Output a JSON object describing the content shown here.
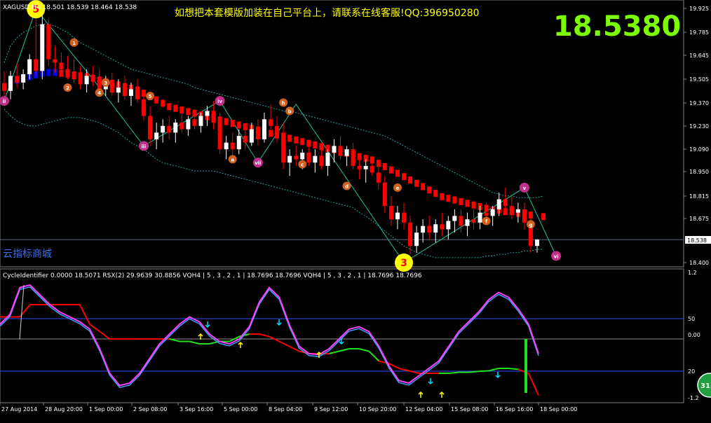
{
  "main": {
    "header": "XAGUSD,H4  18.501 18.539 18.464 18.538",
    "promo": "如想把本套模版加装在自己平台上，请联系在线客服!QQ:396950280",
    "big_price": "18.5380",
    "current_price_label": "18.538",
    "watermark": "云指标商城",
    "y_ticks": [
      "19.925",
      "19.785",
      "19.645",
      "19.505",
      "19.370",
      "19.230",
      "19.090",
      "18.950",
      "18.815",
      "18.675",
      "18.538",
      "18.400"
    ],
    "wave_labels": [
      {
        "label": "5",
        "kind": "yellow"
      },
      {
        "label": "3",
        "kind": "yellow"
      },
      {
        "label": "ii",
        "kind": "magenta"
      },
      {
        "label": "iii",
        "kind": "magenta"
      },
      {
        "label": "iv",
        "kind": "magenta"
      },
      {
        "label": "v",
        "kind": "magenta"
      },
      {
        "label": "vi",
        "kind": "magenta"
      },
      {
        "label": "vii",
        "kind": "magenta"
      },
      {
        "label": "1",
        "kind": "orange"
      },
      {
        "label": "2",
        "kind": "orange"
      },
      {
        "label": "3",
        "kind": "orange"
      },
      {
        "label": "4",
        "kind": "orange"
      },
      {
        "label": "5",
        "kind": "orange"
      },
      {
        "label": "a",
        "kind": "orange"
      },
      {
        "label": "b",
        "kind": "orange"
      },
      {
        "label": "c",
        "kind": "orange"
      },
      {
        "label": "d",
        "kind": "orange"
      },
      {
        "label": "e",
        "kind": "orange"
      },
      {
        "label": "f",
        "kind": "orange"
      },
      {
        "label": "g",
        "kind": "orange"
      },
      {
        "label": "h",
        "kind": "orange"
      }
    ]
  },
  "sub": {
    "header": "CycleIdentifier 0.0000 18.5071  RSX(2) 29.9639 30.8856  VQH4 | 5 , 3 , 2 , 1 |  18.7696 18.7696  VQH4 | 5 , 3 , 2 , 1 |  18.7696 18.7696",
    "y_ticks": [
      "1.2",
      "50",
      "0.00",
      "20",
      "-1.2"
    ]
  },
  "x_ticks": [
    "27 Aug 2014",
    "28 Aug 20:00",
    "1 Sep 00:00",
    "2 Sep 08:00",
    "3 Sep 16:00",
    "5 Sep 00:00",
    "8 Sep 04:00",
    "9 Sep 12:00",
    "10 Sep 20:00",
    "12 Sep 04:00",
    "15 Sep 08:00",
    "16 Sep 16:00",
    "18 Sep 00:00"
  ],
  "badge": "31",
  "colors": {
    "background": "#000000",
    "bull": "#ffffff",
    "bear": "#ff0000",
    "ma_red": "#ff0000",
    "ma_blue": "#0000ff",
    "band": "#2fa0a0",
    "zigzag": "#20c0a0",
    "rsx": "#ff40ff",
    "rsx2": "#40a0ff",
    "vq_red": "#ff0000",
    "vq_green": "#20e020",
    "level": "#3050ff",
    "price_line": "#8090b0",
    "yellow": "#ffff00",
    "magenta": "#c0308a",
    "orange": "#d06020",
    "big_price": "#7cfc00",
    "arrow_yellow": "#ffff00",
    "arrow_cyan": "#00e0ff"
  },
  "chart_data": [
    {
      "type": "candlestick",
      "title": "XAGUSD,H4",
      "ylim": [
        18.4,
        19.925
      ],
      "candles": [
        {
          "o": 19.45,
          "h": 19.55,
          "l": 19.4,
          "c": 19.43
        },
        {
          "o": 19.43,
          "h": 19.55,
          "l": 19.38,
          "c": 19.52
        },
        {
          "o": 19.52,
          "h": 19.6,
          "l": 19.45,
          "c": 19.48
        },
        {
          "o": 19.48,
          "h": 19.56,
          "l": 19.44,
          "c": 19.53
        },
        {
          "o": 19.53,
          "h": 19.65,
          "l": 19.5,
          "c": 19.62
        },
        {
          "o": 19.62,
          "h": 19.92,
          "l": 19.52,
          "c": 19.55
        },
        {
          "o": 19.55,
          "h": 19.9,
          "l": 19.5,
          "c": 19.83
        },
        {
          "o": 19.83,
          "h": 19.86,
          "l": 19.58,
          "c": 19.62
        },
        {
          "o": 19.62,
          "h": 19.7,
          "l": 19.54,
          "c": 19.6
        },
        {
          "o": 19.6,
          "h": 19.66,
          "l": 19.52,
          "c": 19.56
        },
        {
          "o": 19.56,
          "h": 19.64,
          "l": 19.5,
          "c": 19.54
        },
        {
          "o": 19.54,
          "h": 19.62,
          "l": 19.48,
          "c": 19.5
        },
        {
          "o": 19.5,
          "h": 19.58,
          "l": 19.44,
          "c": 19.47
        },
        {
          "o": 19.47,
          "h": 19.56,
          "l": 19.42,
          "c": 19.52
        },
        {
          "o": 19.52,
          "h": 19.58,
          "l": 19.46,
          "c": 19.5
        },
        {
          "o": 19.5,
          "h": 19.56,
          "l": 19.42,
          "c": 19.44
        },
        {
          "o": 19.44,
          "h": 19.52,
          "l": 19.4,
          "c": 19.48
        },
        {
          "o": 19.48,
          "h": 19.54,
          "l": 19.4,
          "c": 19.42
        },
        {
          "o": 19.42,
          "h": 19.5,
          "l": 19.36,
          "c": 19.45
        },
        {
          "o": 19.45,
          "h": 19.52,
          "l": 19.38,
          "c": 19.4
        },
        {
          "o": 19.4,
          "h": 19.48,
          "l": 19.34,
          "c": 19.44
        },
        {
          "o": 19.44,
          "h": 19.5,
          "l": 19.36,
          "c": 19.38
        },
        {
          "o": 19.38,
          "h": 19.44,
          "l": 19.25,
          "c": 19.28
        },
        {
          "o": 19.28,
          "h": 19.34,
          "l": 19.1,
          "c": 19.14
        },
        {
          "o": 19.14,
          "h": 19.24,
          "l": 19.08,
          "c": 19.18
        },
        {
          "o": 19.18,
          "h": 19.26,
          "l": 19.12,
          "c": 19.22
        },
        {
          "o": 19.22,
          "h": 19.28,
          "l": 19.14,
          "c": 19.18
        },
        {
          "o": 19.18,
          "h": 19.26,
          "l": 19.12,
          "c": 19.24
        },
        {
          "o": 19.24,
          "h": 19.3,
          "l": 19.18,
          "c": 19.2
        },
        {
          "o": 19.2,
          "h": 19.28,
          "l": 19.16,
          "c": 19.26
        },
        {
          "o": 19.26,
          "h": 19.32,
          "l": 19.2,
          "c": 19.22
        },
        {
          "o": 19.22,
          "h": 19.3,
          "l": 19.18,
          "c": 19.28
        },
        {
          "o": 19.28,
          "h": 19.34,
          "l": 19.22,
          "c": 19.31
        },
        {
          "o": 19.31,
          "h": 19.37,
          "l": 19.2,
          "c": 19.24
        },
        {
          "o": 19.24,
          "h": 19.3,
          "l": 19.05,
          "c": 19.08
        },
        {
          "o": 19.08,
          "h": 19.16,
          "l": 19.02,
          "c": 19.12
        },
        {
          "o": 19.12,
          "h": 19.18,
          "l": 19.04,
          "c": 19.08
        },
        {
          "o": 19.08,
          "h": 19.2,
          "l": 19.05,
          "c": 19.16
        },
        {
          "o": 19.16,
          "h": 19.22,
          "l": 19.08,
          "c": 19.12
        },
        {
          "o": 19.12,
          "h": 19.24,
          "l": 19.1,
          "c": 19.2
        },
        {
          "o": 19.2,
          "h": 19.26,
          "l": 19.1,
          "c": 19.14
        },
        {
          "o": 19.14,
          "h": 19.3,
          "l": 19.12,
          "c": 19.26
        },
        {
          "o": 19.26,
          "h": 19.35,
          "l": 19.2,
          "c": 19.22
        },
        {
          "o": 19.22,
          "h": 19.28,
          "l": 19.12,
          "c": 19.18
        },
        {
          "o": 19.18,
          "h": 19.24,
          "l": 18.96,
          "c": 19.0
        },
        {
          "o": 19.0,
          "h": 19.08,
          "l": 18.92,
          "c": 19.04
        },
        {
          "o": 19.04,
          "h": 19.1,
          "l": 18.98,
          "c": 19.02
        },
        {
          "o": 19.02,
          "h": 19.08,
          "l": 18.96,
          "c": 19.06
        },
        {
          "o": 19.06,
          "h": 19.12,
          "l": 18.98,
          "c": 19.0
        },
        {
          "o": 19.0,
          "h": 19.08,
          "l": 18.94,
          "c": 19.04
        },
        {
          "o": 19.04,
          "h": 19.1,
          "l": 18.96,
          "c": 18.98
        },
        {
          "o": 18.98,
          "h": 19.08,
          "l": 18.92,
          "c": 19.06
        },
        {
          "o": 19.06,
          "h": 19.14,
          "l": 19.0,
          "c": 19.1
        },
        {
          "o": 19.1,
          "h": 19.16,
          "l": 19.02,
          "c": 19.04
        },
        {
          "o": 19.04,
          "h": 19.1,
          "l": 18.98,
          "c": 19.08
        },
        {
          "o": 19.08,
          "h": 19.12,
          "l": 18.96,
          "c": 18.98
        },
        {
          "o": 18.98,
          "h": 19.04,
          "l": 18.9,
          "c": 18.96
        },
        {
          "o": 18.96,
          "h": 19.02,
          "l": 18.88,
          "c": 18.98
        },
        {
          "o": 18.98,
          "h": 19.04,
          "l": 18.92,
          "c": 18.94
        },
        {
          "o": 18.94,
          "h": 18.98,
          "l": 18.84,
          "c": 18.88
        },
        {
          "o": 18.88,
          "h": 18.92,
          "l": 18.7,
          "c": 18.74
        },
        {
          "o": 18.74,
          "h": 18.8,
          "l": 18.62,
          "c": 18.66
        },
        {
          "o": 18.66,
          "h": 18.74,
          "l": 18.6,
          "c": 18.7
        },
        {
          "o": 18.7,
          "h": 18.76,
          "l": 18.6,
          "c": 18.64
        },
        {
          "o": 18.64,
          "h": 18.68,
          "l": 18.45,
          "c": 18.5
        },
        {
          "o": 18.5,
          "h": 18.62,
          "l": 18.46,
          "c": 18.58
        },
        {
          "o": 18.58,
          "h": 18.66,
          "l": 18.52,
          "c": 18.62
        },
        {
          "o": 18.62,
          "h": 18.68,
          "l": 18.54,
          "c": 18.58
        },
        {
          "o": 18.58,
          "h": 18.66,
          "l": 18.52,
          "c": 18.63
        },
        {
          "o": 18.63,
          "h": 18.7,
          "l": 18.56,
          "c": 18.6
        },
        {
          "o": 18.6,
          "h": 18.68,
          "l": 18.54,
          "c": 18.65
        },
        {
          "o": 18.65,
          "h": 18.72,
          "l": 18.58,
          "c": 18.68
        },
        {
          "o": 18.68,
          "h": 18.72,
          "l": 18.58,
          "c": 18.62
        },
        {
          "o": 18.62,
          "h": 18.7,
          "l": 18.56,
          "c": 18.66
        },
        {
          "o": 18.66,
          "h": 18.72,
          "l": 18.6,
          "c": 18.64
        },
        {
          "o": 18.64,
          "h": 18.74,
          "l": 18.6,
          "c": 18.7
        },
        {
          "o": 18.7,
          "h": 18.76,
          "l": 18.64,
          "c": 18.68
        },
        {
          "o": 18.68,
          "h": 18.74,
          "l": 18.62,
          "c": 18.72
        },
        {
          "o": 18.72,
          "h": 18.82,
          "l": 18.68,
          "c": 18.78
        },
        {
          "o": 18.78,
          "h": 18.85,
          "l": 18.7,
          "c": 18.74
        },
        {
          "o": 18.74,
          "h": 18.8,
          "l": 18.66,
          "c": 18.7
        },
        {
          "o": 18.7,
          "h": 18.76,
          "l": 18.64,
          "c": 18.72
        },
        {
          "o": 18.72,
          "h": 18.76,
          "l": 18.6,
          "c": 18.64
        },
        {
          "o": 18.64,
          "h": 18.7,
          "l": 18.46,
          "c": 18.5
        },
        {
          "o": 18.5,
          "h": 18.54,
          "l": 18.46,
          "c": 18.538
        }
      ],
      "ma": [
        19.46,
        19.48,
        19.5,
        19.51,
        19.52,
        19.53,
        19.54,
        19.545,
        19.545,
        19.54,
        19.535,
        19.53,
        19.525,
        19.52,
        19.51,
        19.5,
        19.49,
        19.48,
        19.47,
        19.46,
        19.45,
        19.44,
        19.42,
        19.4,
        19.38,
        19.36,
        19.34,
        19.33,
        19.32,
        19.31,
        19.3,
        19.29,
        19.28,
        19.27,
        19.26,
        19.25,
        19.24,
        19.23,
        19.22,
        19.21,
        19.2,
        19.19,
        19.18,
        19.17,
        19.16,
        19.15,
        19.14,
        19.13,
        19.12,
        19.11,
        19.1,
        19.09,
        19.08,
        19.07,
        19.06,
        19.05,
        19.04,
        19.03,
        19.02,
        19.0,
        18.98,
        18.96,
        18.94,
        18.92,
        18.9,
        18.88,
        18.86,
        18.84,
        18.82,
        18.8,
        18.79,
        18.78,
        18.77,
        18.76,
        18.75,
        18.74,
        18.73,
        18.72,
        18.72,
        18.71,
        18.71,
        18.7,
        18.7,
        18.69,
        18.69,
        18.68
      ],
      "band_upper": [
        19.6,
        19.7,
        19.75,
        19.78,
        19.8,
        19.82,
        19.83,
        19.83,
        19.82,
        19.8,
        19.78,
        19.75,
        19.72,
        19.7,
        19.68,
        19.66,
        19.64,
        19.62,
        19.6,
        19.58,
        19.56,
        19.55,
        19.54,
        19.53,
        19.52,
        19.51,
        19.5,
        19.49,
        19.48,
        19.47,
        19.45,
        19.44,
        19.43,
        19.42,
        19.41,
        19.4,
        19.39,
        19.38,
        19.37,
        19.36,
        19.35,
        19.34,
        19.33,
        19.32,
        19.31,
        19.3,
        19.3,
        19.29,
        19.28,
        19.27,
        19.26,
        19.25,
        19.24,
        19.23,
        19.22,
        19.21,
        19.2,
        19.19,
        19.18,
        19.17,
        19.16,
        19.14,
        19.12,
        19.1,
        19.08,
        19.06,
        19.04,
        19.02,
        19.0,
        18.98,
        18.96,
        18.94,
        18.92,
        18.9,
        18.88,
        18.86,
        18.84,
        18.82,
        18.81,
        18.8,
        18.8,
        18.79,
        18.79,
        18.79,
        18.79,
        18.8
      ],
      "band_lower": [
        19.32,
        19.28,
        19.25,
        19.23,
        19.22,
        19.22,
        19.23,
        19.24,
        19.25,
        19.26,
        19.27,
        19.27,
        19.27,
        19.26,
        19.25,
        19.24,
        19.22,
        19.2,
        19.18,
        19.15,
        19.12,
        19.1,
        19.08,
        19.05,
        19.02,
        19.0,
        18.99,
        18.98,
        18.97,
        18.96,
        18.95,
        18.95,
        18.95,
        18.95,
        18.94,
        18.93,
        18.92,
        18.91,
        18.9,
        18.89,
        18.88,
        18.87,
        18.86,
        18.85,
        18.84,
        18.83,
        18.82,
        18.81,
        18.8,
        18.79,
        18.78,
        18.77,
        18.76,
        18.75,
        18.74,
        18.73,
        18.7,
        18.68,
        18.65,
        18.62,
        18.59,
        18.56,
        18.53,
        18.5,
        18.48,
        18.46,
        18.45,
        18.44,
        18.43,
        18.43,
        18.43,
        18.43,
        18.43,
        18.43,
        18.43,
        18.43,
        18.44,
        18.44,
        18.45,
        18.45,
        18.46,
        18.46,
        18.47,
        18.47,
        18.48,
        18.48
      ],
      "zigzag": [
        [
          0,
          19.37
        ],
        [
          5,
          19.92
        ],
        [
          14,
          19.5
        ],
        [
          22,
          19.1
        ],
        [
          34,
          19.37
        ],
        [
          40,
          19.0
        ],
        [
          46,
          19.35
        ],
        [
          63,
          18.4
        ],
        [
          82,
          18.85
        ],
        [
          87,
          18.44
        ]
      ]
    },
    {
      "type": "line",
      "title": "CycleIdentifier",
      "ylim": [
        -1.2,
        1.2
      ],
      "levels": [
        50,
        20
      ],
      "series": [
        {
          "name": "RSX(2)",
          "values": [
            0.3,
            0.5,
            1.05,
            1.1,
            0.9,
            0.7,
            0.55,
            0.45,
            0.35,
            0.2,
            -0.2,
            -0.7,
            -0.95,
            -0.9,
            -0.7,
            -0.4,
            -0.1,
            0.1,
            0.3,
            0.45,
            0.35,
            0.1,
            -0.05,
            -0.1,
            0.0,
            0.25,
            0.75,
            1.05,
            0.85,
            0.3,
            -0.15,
            -0.3,
            -0.32,
            -0.2,
            0.0,
            0.2,
            0.25,
            0.15,
            -0.15,
            -0.55,
            -0.85,
            -0.9,
            -0.75,
            -0.6,
            -0.45,
            -0.15,
            0.15,
            0.35,
            0.55,
            0.8,
            0.95,
            0.85,
            0.6,
            0.3,
            -0.3
          ]
        },
        {
          "name": "VQH4",
          "values": [
            0.45,
            0.45,
            0.45,
            0.7,
            0.7,
            0.7,
            0.7,
            0.7,
            0.7,
            0.3,
            0.15,
            0.0,
            0.0,
            0.0,
            0.0,
            0.0,
            0.0,
            0.0,
            -0.05,
            -0.05,
            -0.1,
            -0.1,
            -0.05,
            -0.05,
            0.05,
            0.1,
            0.1,
            0.05,
            -0.05,
            -0.15,
            -0.25,
            -0.3,
            -0.3,
            -0.3,
            -0.25,
            -0.2,
            -0.2,
            -0.25,
            -0.45,
            -0.5,
            -0.6,
            -0.65,
            -0.7,
            -0.7,
            -0.7,
            -0.7,
            -0.68,
            -0.68,
            -0.66,
            -0.65,
            -0.6,
            -0.6,
            -0.62,
            -0.7,
            -1.15
          ]
        }
      ]
    }
  ]
}
